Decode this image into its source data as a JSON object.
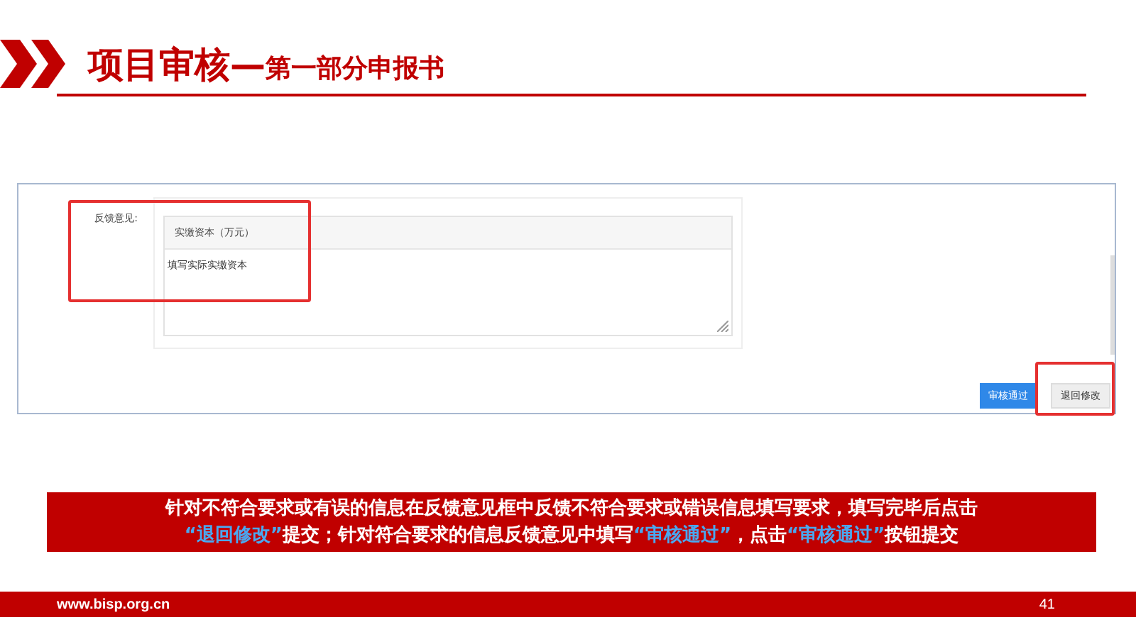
{
  "slide": {
    "title_main": "项目审核—",
    "title_sub": "第一部分申报书"
  },
  "form": {
    "label": "反馈意见:",
    "field_header": "实缴资本（万元）",
    "field_value": "填写实际实缴资本",
    "buttons": [
      {
        "label": "审核通过",
        "kind": "primary"
      },
      {
        "label": "退回修改",
        "kind": "default"
      }
    ]
  },
  "caption": {
    "lines": [
      [
        {
          "text": "针对不符合要求或有误的信息在反馈意见框中反馈不符合要求或错误信息填写要求，填写完毕后点击",
          "highlight": false
        }
      ],
      [
        {
          "text": "“退回修改”",
          "highlight": true
        },
        {
          "text": "提交；针对符合要求的信息反馈意见中填写",
          "highlight": false
        },
        {
          "text": "“审核通过”",
          "highlight": true
        },
        {
          "text": "，点击",
          "highlight": false
        },
        {
          "text": "“审核通过”",
          "highlight": true
        },
        {
          "text": "按钮提交",
          "highlight": false
        }
      ]
    ]
  },
  "footer": {
    "site": "www.bisp.org.cn",
    "page": "41"
  }
}
